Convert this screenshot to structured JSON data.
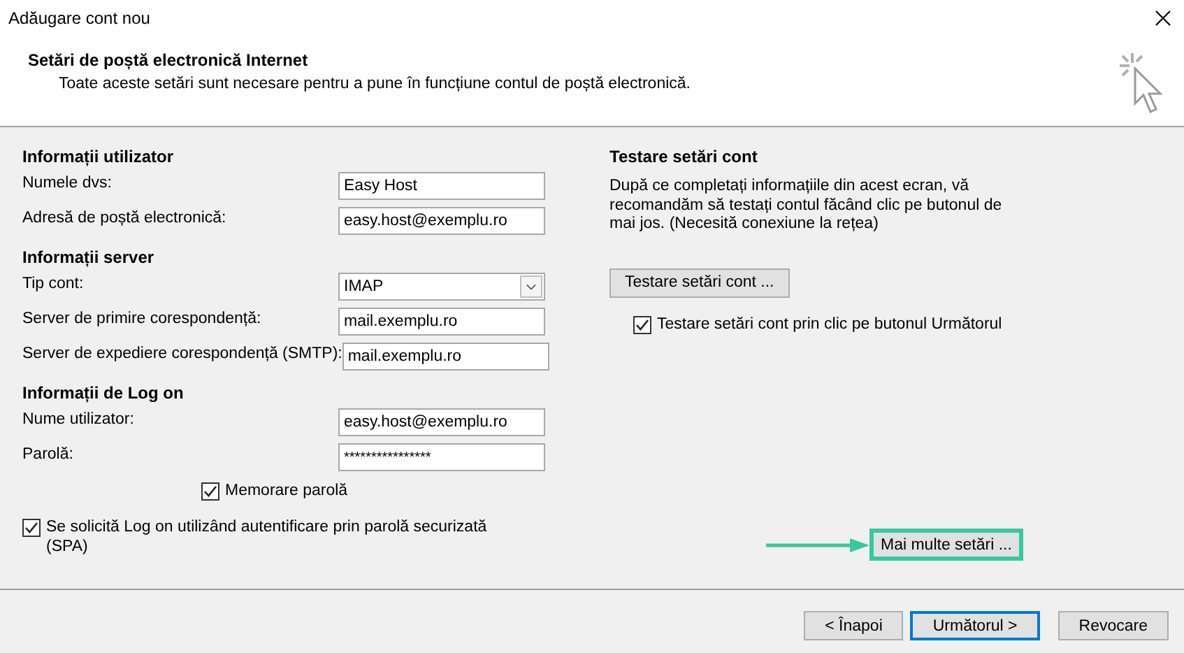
{
  "window": {
    "title": "Adăugare cont nou"
  },
  "header": {
    "title": "Setări de poștă electronică Internet",
    "subtitle": "Toate aceste setări sunt necesare pentru a pune în funcțiune contul de poștă electronică."
  },
  "left": {
    "sections": [
      {
        "heading": "Informații utilizator",
        "fields": [
          {
            "kind": "text",
            "label": "Numele dvs:",
            "value": "Easy Host"
          },
          {
            "kind": "text",
            "label": "Adresă de poștă electronică:",
            "value": "easy.host@exemplu.ro"
          }
        ]
      },
      {
        "heading": "Informații server",
        "fields": [
          {
            "kind": "select",
            "label": "Tip cont:",
            "value": "IMAP"
          },
          {
            "kind": "text",
            "label": "Server de primire corespondență:",
            "value": "mail.exemplu.ro"
          },
          {
            "kind": "text",
            "label": "Server de expediere corespondență (SMTP):",
            "value": "mail.exemplu.ro"
          }
        ]
      },
      {
        "heading": "Informații de Log on",
        "fields": [
          {
            "kind": "text",
            "label": "Nume utilizator:",
            "value": "easy.host@exemplu.ro"
          },
          {
            "kind": "password",
            "label": "Parolă:",
            "value": "****************"
          }
        ]
      }
    ],
    "remember": {
      "label": "Memorare parolă",
      "checked": true
    },
    "spa": {
      "label": "Se solicită Log on utilizând autentificare prin parolă securizată (SPA)",
      "checked": true
    }
  },
  "right": {
    "heading": "Testare setări cont",
    "text": "După ce completați informațiile din acest ecran, vă recomandăm să testați contul făcând clic pe butonul de mai jos. (Necesită conexiune la rețea)",
    "test_button": "Testare setări cont ...",
    "auto_test": {
      "label": "Testare setări cont prin clic pe butonul Următorul",
      "checked": true
    },
    "more_button": {
      "label": "Mai multe setări ...",
      "highlighted": true
    }
  },
  "footer": {
    "buttons": [
      {
        "label": "< Înapoi",
        "default": false
      },
      {
        "label": "Următorul >",
        "default": true
      },
      {
        "label": "Revocare",
        "default": false
      }
    ]
  }
}
